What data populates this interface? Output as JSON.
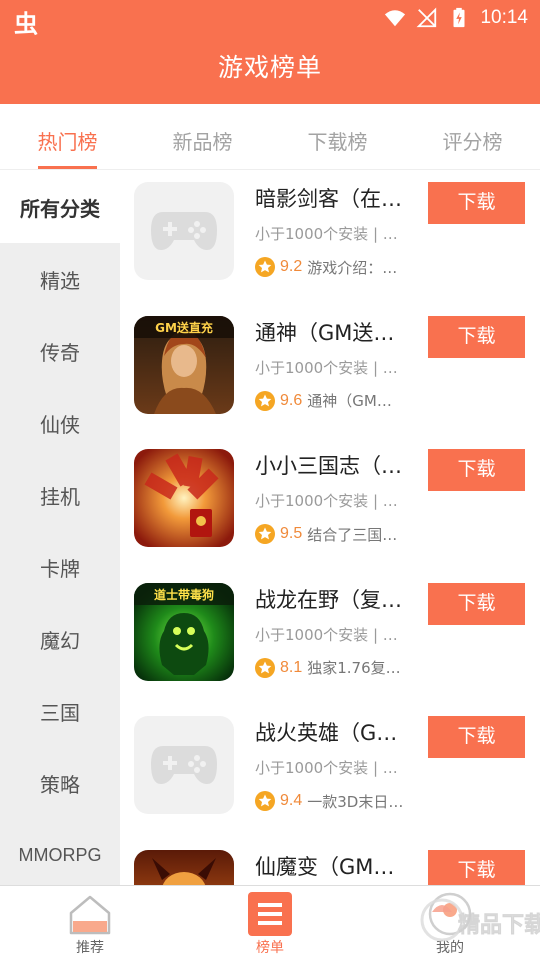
{
  "status_bar": {
    "time": "10:14",
    "logo_text": "虫"
  },
  "header": {
    "title": "游戏榜单"
  },
  "tabs": [
    {
      "label": "热门榜",
      "active": true
    },
    {
      "label": "新品榜",
      "active": false
    },
    {
      "label": "下载榜",
      "active": false
    },
    {
      "label": "评分榜",
      "active": false
    }
  ],
  "sidebar": {
    "items": [
      {
        "label": "所有分类",
        "active": true
      },
      {
        "label": "精选"
      },
      {
        "label": "传奇"
      },
      {
        "label": "仙侠"
      },
      {
        "label": "挂机"
      },
      {
        "label": "卡牌"
      },
      {
        "label": "魔幻"
      },
      {
        "label": "三国"
      },
      {
        "label": "策略"
      },
      {
        "label": "MMORPG"
      }
    ]
  },
  "games": [
    {
      "title": "暗影剑客（在…",
      "subtitle": "小于1000个安装 | …",
      "score": "9.2",
      "desc": "游戏介绍：…",
      "button": "下载",
      "icon": "gamepad-placeholder-icon",
      "icon_badge": ""
    },
    {
      "title": "通神（GM送…",
      "subtitle": "小于1000个安装 | …",
      "score": "9.6",
      "desc": "通神（GM…",
      "button": "下载",
      "icon": "warrior-woman-icon",
      "icon_badge": "GM送直充"
    },
    {
      "title": "小小三国志（…",
      "subtitle": "小于1000个安装 | …",
      "score": "9.5",
      "desc": "结合了三国…",
      "button": "下载",
      "icon": "red-explosion-icon",
      "icon_badge": ""
    },
    {
      "title": "战龙在野（复…",
      "subtitle": "小于1000个安装 | …",
      "score": "8.1",
      "desc": "独家1.76复…",
      "button": "下载",
      "icon": "green-beast-icon",
      "icon_badge": "道士带毒狗"
    },
    {
      "title": "战火英雄（G…",
      "subtitle": "小于1000个安装 | …",
      "score": "9.4",
      "desc": "一款3D末日…",
      "button": "下载",
      "icon": "gamepad-placeholder-icon",
      "icon_badge": ""
    },
    {
      "title": "仙魔变（GM…",
      "subtitle": "",
      "score": "",
      "desc": "",
      "button": "下载",
      "icon": "fire-demon-icon",
      "icon_badge": ""
    }
  ],
  "bottom_nav": [
    {
      "label": "推荐",
      "icon": "home-icon",
      "active": false
    },
    {
      "label": "榜单",
      "icon": "list-icon",
      "active": true
    },
    {
      "label": "我的",
      "icon": "profile-icon",
      "active": false
    }
  ],
  "watermark": {
    "text": "精品下载"
  },
  "colors": {
    "accent": "#f9714f",
    "star": "#f5a623",
    "sidebar_bg": "#eeeeee"
  }
}
